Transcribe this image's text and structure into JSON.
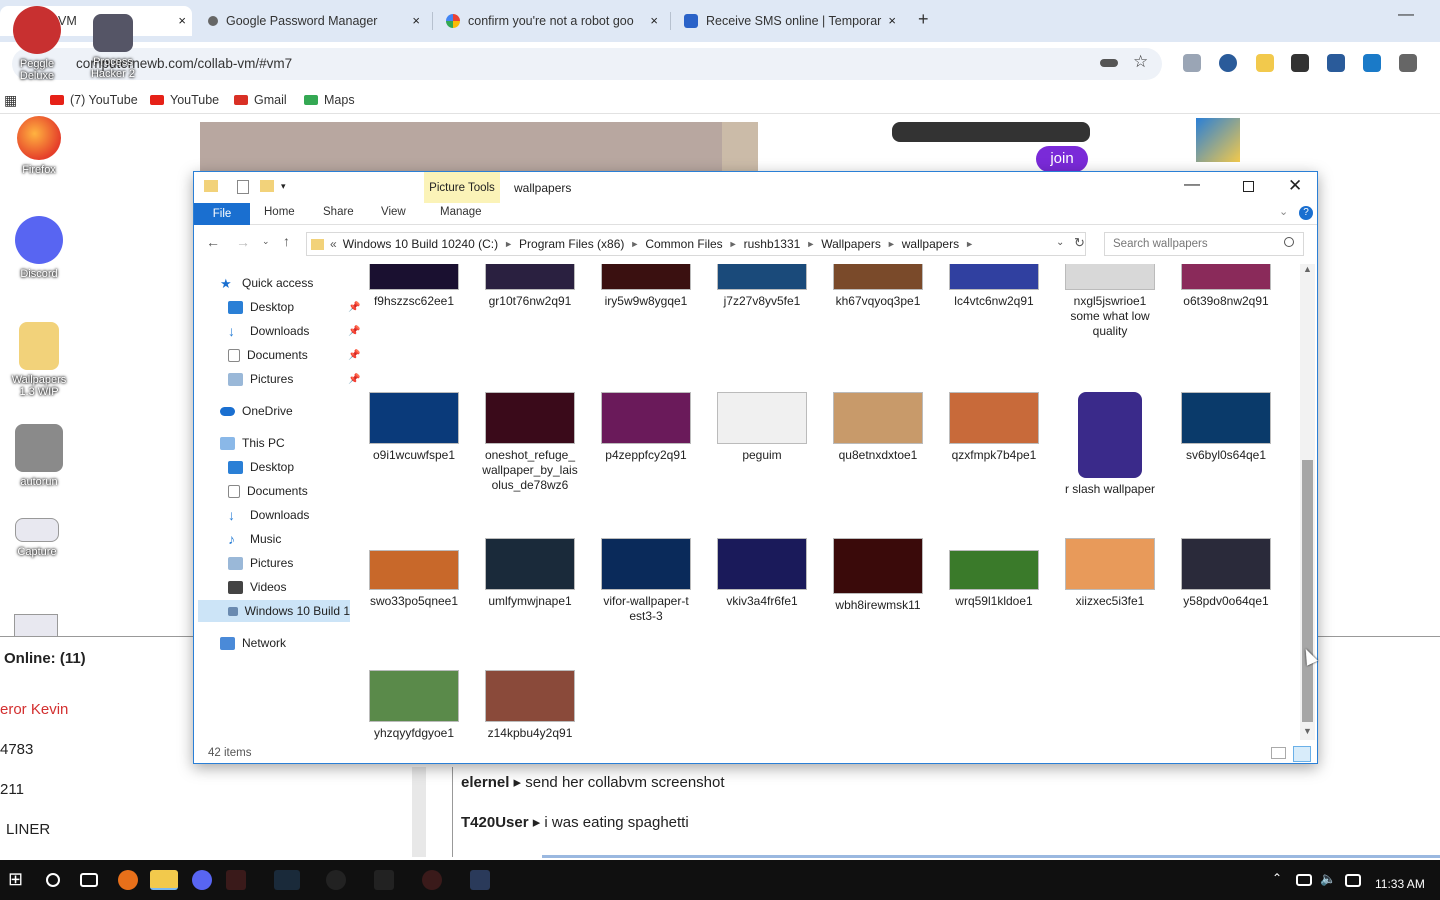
{
  "browser": {
    "tabs": [
      {
        "label": "VM",
        "active": true
      },
      {
        "label": "Google Password Manager"
      },
      {
        "label": "confirm you're not a robot goo"
      },
      {
        "label": "Receive SMS online | Temporar"
      }
    ],
    "new_tab": "+",
    "close_glyph": "×",
    "url": "computernewb.com/collab-vm/#vm7",
    "bookmarks": [
      "(7) YouTube",
      "YouTube",
      "Gmail",
      "Maps"
    ]
  },
  "desktop": {
    "icons": [
      "Peggle Deluxe",
      "Process Hacker 2",
      "Firefox",
      "Discord",
      "Wallpapers 1.3 WIP",
      "autorun",
      "Capture"
    ],
    "join_label": "join"
  },
  "explorer": {
    "title": "wallpapers",
    "picture_tools": "Picture Tools",
    "ribbon_tabs": [
      "File",
      "Home",
      "Share",
      "View",
      "Manage"
    ],
    "breadcrumbs": [
      "Windows 10 Build 10240 (C:)",
      "Program Files (x86)",
      "Common Files",
      "rushb1331",
      "Wallpapers",
      "wallpapers"
    ],
    "search_placeholder": "Search wallpapers",
    "nav": {
      "quick_access": "Quick access",
      "qa_items": [
        "Desktop",
        "Downloads",
        "Documents",
        "Pictures"
      ],
      "onedrive": "OneDrive",
      "this_pc": "This PC",
      "pc_items": [
        "Desktop",
        "Documents",
        "Downloads",
        "Music",
        "Pictures",
        "Videos",
        "Windows 10 Build 1"
      ],
      "network": "Network"
    },
    "files": [
      {
        "name": "f9hszzsc62ee1",
        "color": "#1a1030"
      },
      {
        "name": "gr10t76nw2q91",
        "color": "#2a2040"
      },
      {
        "name": "iry5w9w8ygqe1",
        "color": "#3a1010"
      },
      {
        "name": "j7z27v8yv5fe1",
        "color": "#1a4a7a"
      },
      {
        "name": "kh67vqyoq3pe1",
        "color": "#7a4a2a"
      },
      {
        "name": "lc4vtc6nw2q91",
        "color": "#3040a0"
      },
      {
        "name": "nxgl5jswrioe1 some what low quality",
        "color": "#d8d8d8"
      },
      {
        "name": "o6t39o8nw2q91",
        "color": "#8a2a5a"
      },
      {
        "name": "o9i1wcuwfspe1",
        "color": "#0a3a7a"
      },
      {
        "name": "oneshot_refuge_ wallpaper_by_lais olus_de78wz6",
        "color": "#3a0a1a"
      },
      {
        "name": "p4zeppfcy2q91",
        "color": "#6a1a5a"
      },
      {
        "name": "peguim",
        "color": "#f0f0f0"
      },
      {
        "name": "qu8etnxdxtoe1",
        "color": "#c89a6a"
      },
      {
        "name": "qzxfmpk7b4pe1",
        "color": "#c86a3a"
      },
      {
        "name": "r slash wallpaper",
        "color": "#3a2a8a"
      },
      {
        "name": "sv6byl0s64qe1",
        "color": "#0a3a6a"
      },
      {
        "name": "swo33po5qnee1",
        "color": "#c8682a"
      },
      {
        "name": "umlfymwjnape1",
        "color": "#1a2a3a"
      },
      {
        "name": "vifor-wallpaper-t est3-3",
        "color": "#0a2a5a"
      },
      {
        "name": "vkiv3a4fr6fe1",
        "color": "#1a1a5a"
      },
      {
        "name": "wbh8irewmsk11",
        "color": "#3a0a0a"
      },
      {
        "name": "wrq59l1kldoe1",
        "color": "#3a7a2a"
      },
      {
        "name": "xiizxec5i3fe1",
        "color": "#e89a5a"
      },
      {
        "name": "y58pdv0o64qe1",
        "color": "#2a2a3a"
      },
      {
        "name": "yhzqyyfdgyoe1",
        "color": "#5a8a4a"
      },
      {
        "name": "z14kpbu4y2q91",
        "color": "#8a4a3a"
      }
    ],
    "status": "42 items"
  },
  "chat": {
    "online": "Online: (11)",
    "users": [
      "eror Kevin",
      "4783",
      "211",
      "LINER"
    ],
    "messages": [
      {
        "user": "elernel",
        "text": "send her collabvm screenshot"
      },
      {
        "user": "T420User",
        "text": "i was eating spaghetti"
      }
    ]
  },
  "taskbar": {
    "time": "11:33 AM"
  },
  "colors": {
    "accent": "#2a7fd6",
    "select": "#cce4f7",
    "taskbar": "#101010"
  }
}
